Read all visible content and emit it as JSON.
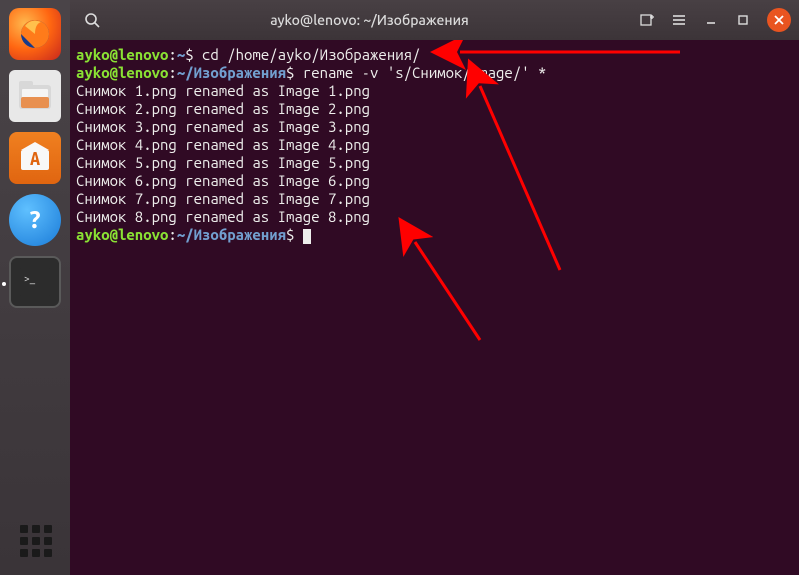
{
  "titlebar": {
    "title": "ayko@lenovo: ~/Изображения"
  },
  "dock": {
    "items": [
      {
        "name": "firefox",
        "label": "Firefox"
      },
      {
        "name": "files",
        "label": "Files"
      },
      {
        "name": "software",
        "label": "Ubuntu Software"
      },
      {
        "name": "help",
        "label": "Help"
      },
      {
        "name": "terminal",
        "label": "Terminal"
      }
    ]
  },
  "prompt1": {
    "user": "ayko@lenovo",
    "sep": ":",
    "path": "~",
    "sym": "$",
    "cmd": " cd /home/ayko/Изображения/"
  },
  "prompt2": {
    "user": "ayko@lenovo",
    "sep": ":",
    "path": "~/Изображения",
    "sym": "$",
    "cmd": " rename -v 's/Снимок/Image/' *"
  },
  "output": [
    "Снимок 1.png renamed as Image 1.png",
    "Снимок 2.png renamed as Image 2.png",
    "Снимок 3.png renamed as Image 3.png",
    "Снимок 4.png renamed as Image 4.png",
    "Снимок 5.png renamed as Image 5.png",
    "Снимок 6.png renamed as Image 6.png",
    "Снимок 7.png renamed as Image 7.png",
    "Снимок 8.png renamed as Image 8.png"
  ],
  "prompt3": {
    "user": "ayko@lenovo",
    "sep": ":",
    "path": "~/Изображения",
    "sym": "$",
    "cmd": " "
  },
  "colors": {
    "terminal_bg": "#300a24",
    "user_green": "#8ae234",
    "path_blue": "#729fcf",
    "close_orange": "#e95420"
  },
  "annotations": {
    "arrows": 3,
    "color": "#ff0000"
  }
}
